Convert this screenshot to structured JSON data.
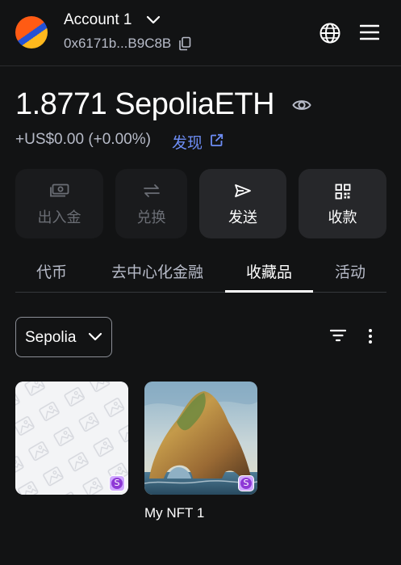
{
  "header": {
    "account_name": "Account 1",
    "address": "0x6171b...B9C8B",
    "icons": [
      "account-avatar",
      "chevron-down-icon",
      "copy-icon",
      "globe-icon",
      "menu-icon"
    ]
  },
  "balance": {
    "amount": "1.8771",
    "currency": "SepoliaETH",
    "fiat": "+US$0.00 (+0.00%)",
    "discover_label": "发现"
  },
  "actions": [
    {
      "label": "出入金",
      "icon": "buy-sell-icon",
      "enabled": false
    },
    {
      "label": "兑换",
      "icon": "swap-icon",
      "enabled": false
    },
    {
      "label": "发送",
      "icon": "send-icon",
      "enabled": true
    },
    {
      "label": "收款",
      "icon": "qr-code-icon",
      "enabled": true
    }
  ],
  "tabs": [
    {
      "label": "代币",
      "active": false
    },
    {
      "label": "去中心化金融",
      "active": false
    },
    {
      "label": "收藏品",
      "active": true
    },
    {
      "label": "活动",
      "active": false
    }
  ],
  "collectibles": {
    "network_filter": "Sepolia",
    "items": [
      {
        "name": "",
        "network_badge": "S",
        "image": "placeholder"
      },
      {
        "name": "My NFT 1",
        "network_badge": "S",
        "image": "sea-arch-rock"
      }
    ]
  },
  "colors": {
    "background": "#121314",
    "text_muted": "#b7bbc8",
    "link": "#6d8df5",
    "badge": "#8e39d6"
  }
}
